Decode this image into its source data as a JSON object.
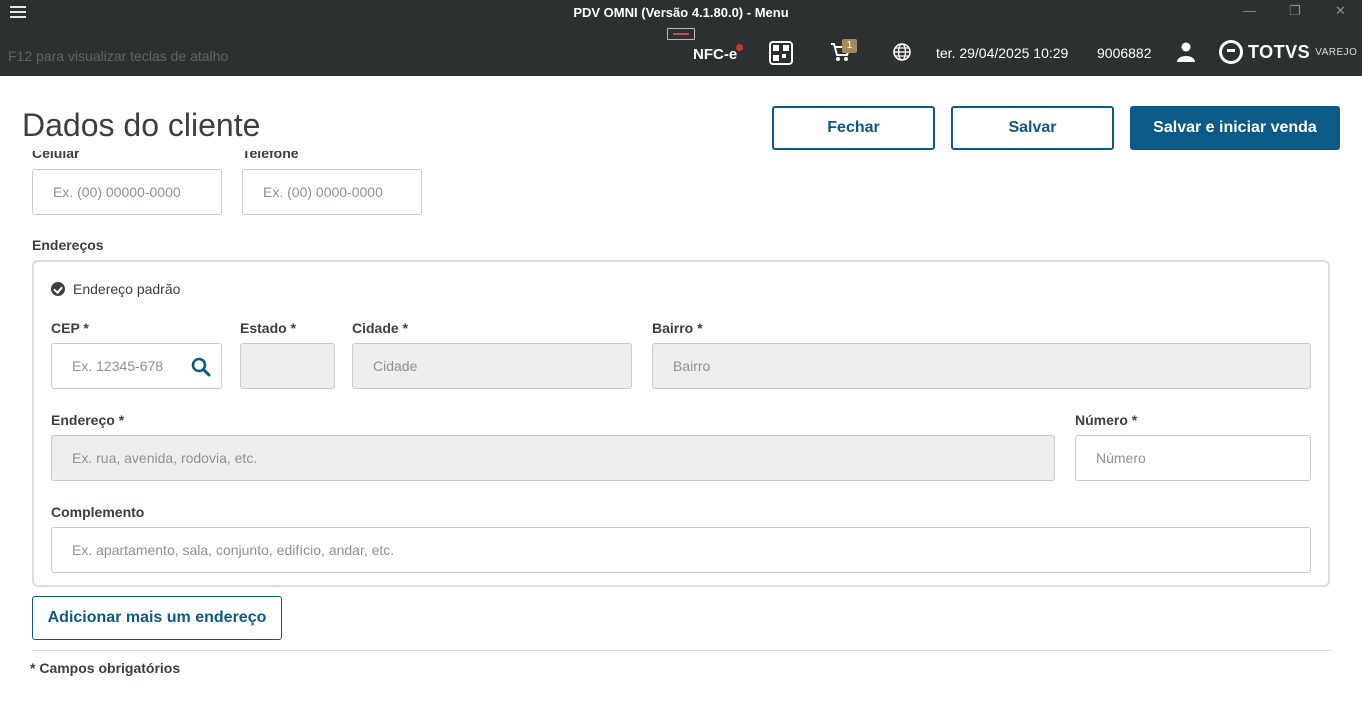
{
  "window": {
    "title": "PDV OMNI (Versão 4.1.80.0) - Menu",
    "minimize": "—",
    "maximize": "❐",
    "close": "✕"
  },
  "header": {
    "shortcut_hint": "F12 para visualizar teclas de atalho",
    "nfce_label": "NFC-e",
    "cart_count": "1",
    "datetime": "ter. 29/04/2025 10:29",
    "user_id": "9006882",
    "logo_text": "TOTVS",
    "logo_sub": "VAREJO",
    "icons": [
      "menu-icon",
      "usb-icon",
      "qr-code-icon",
      "cart-icon",
      "globe-icon",
      "user-icon"
    ]
  },
  "page": {
    "title": "Dados do cliente"
  },
  "actions": {
    "close_label": "Fechar",
    "save_label": "Salvar",
    "save_start_label": "Salvar e iniciar venda"
  },
  "contact": {
    "mobile_label": "Celular",
    "mobile_placeholder": "Ex. (00) 00000-0000",
    "phone_label": "Telefone",
    "phone_placeholder": "Ex. (00) 0000-0000"
  },
  "addresses": {
    "section_label": "Endereços",
    "default_label": "Endereço padrão",
    "cep_label": "CEP *",
    "cep_placeholder": "Ex. 12345-678",
    "state_label": "Estado *",
    "state_placeholder": "",
    "city_label": "Cidade *",
    "city_placeholder": "Cidade",
    "district_label": "Bairro *",
    "district_placeholder": "Bairro",
    "street_label": "Endereço *",
    "street_placeholder": "Ex. rua, avenida, rodovia, etc.",
    "number_label": "Número *",
    "number_placeholder": "Número",
    "complement_label": "Complemento",
    "complement_placeholder": "Ex. apartamento, sala, conjunto, edifício, andar, etc.",
    "add_button_label": "Adicionar mais um endereço"
  },
  "footer": {
    "required_note": "* Campos obrigatórios"
  },
  "colors": {
    "titlebar_bg": "#2b3030",
    "primary": "#0c5a87",
    "disabled_field": "#eeeeee"
  }
}
